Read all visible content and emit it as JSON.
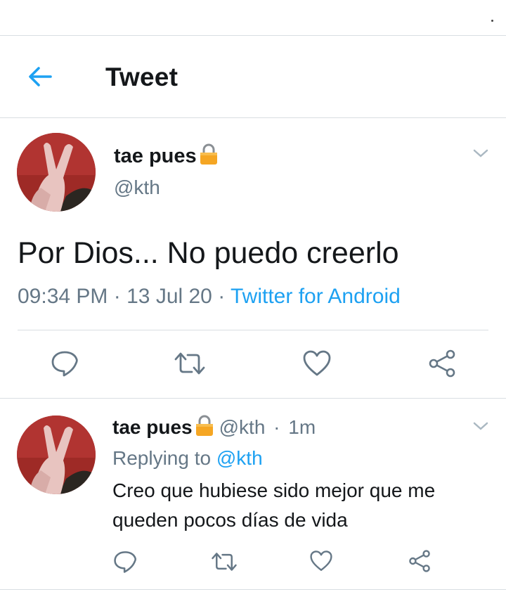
{
  "header": {
    "title": "Tweet",
    "back_icon": "arrow-left-icon"
  },
  "colors": {
    "accent": "#1da1f2",
    "secondary_text": "#657786",
    "divider": "#d9dee2",
    "lock": "#f5a623"
  },
  "main_tweet": {
    "display_name": "tae pues",
    "handle": "@kth",
    "text": "Por Dios... No puedo creerlo",
    "time": "09:34 PM",
    "date": "13 Jul 20",
    "source": "Twitter for Android",
    "separator": "·",
    "actions": [
      "reply-icon",
      "retweet-icon",
      "like-icon",
      "share-icon"
    ]
  },
  "reply_tweet": {
    "display_name": "tae pues",
    "handle": "@kth",
    "separator": "·",
    "age": "1m",
    "replying_label": "Replying to",
    "replying_to": "@kth",
    "text": "Creo que hubiese sido mejor que me queden pocos días de vida",
    "actions": [
      "reply-icon",
      "retweet-icon",
      "like-icon",
      "share-icon"
    ]
  }
}
